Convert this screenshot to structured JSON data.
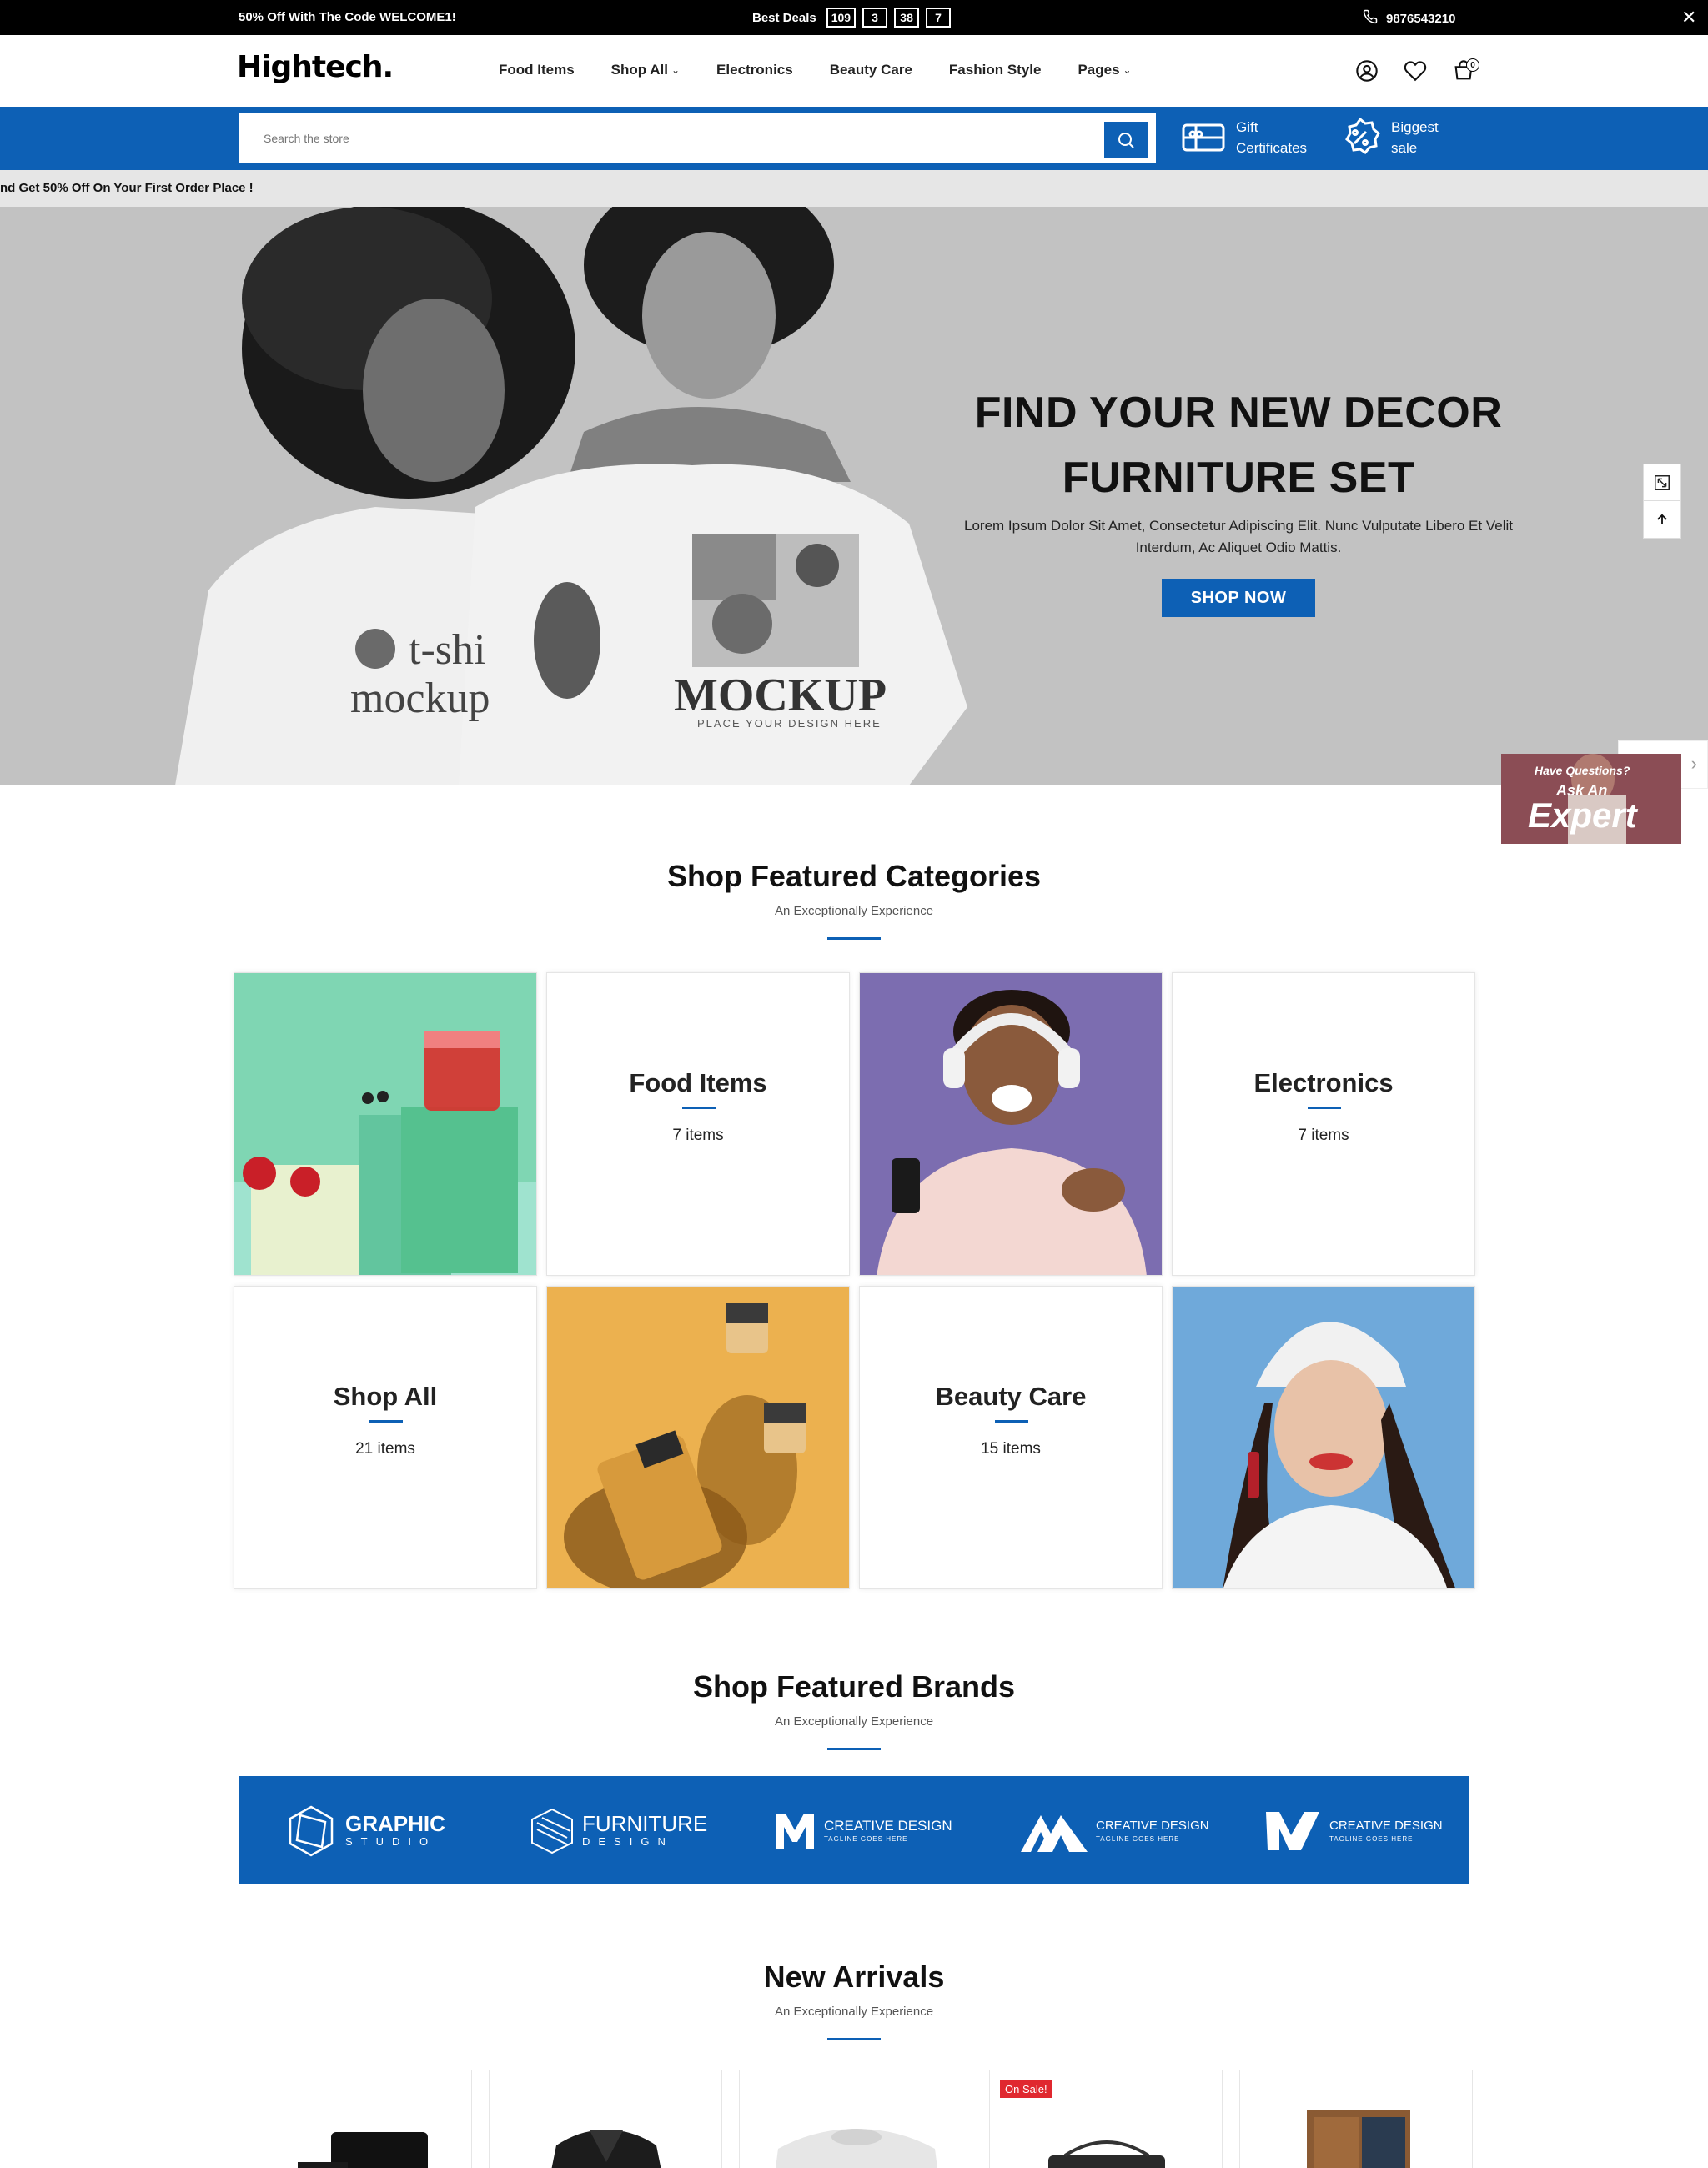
{
  "topbar": {
    "promo": "50% Off With The Code WELCOME1!",
    "deals_label": "Best Deals",
    "countdown": [
      "109",
      "3",
      "38",
      "7"
    ],
    "phone": "9876543210",
    "close": "✕"
  },
  "header": {
    "logo": "Hightech.",
    "nav": [
      {
        "label": "Food Items"
      },
      {
        "label": "Shop All",
        "dropdown": true
      },
      {
        "label": "Electronics"
      },
      {
        "label": "Beauty Care"
      },
      {
        "label": "Fashion Style"
      },
      {
        "label": "Pages",
        "dropdown": true
      }
    ],
    "cart_count": "0",
    "icons": [
      "account-icon",
      "wishlist-heart-icon",
      "cart-bag-icon"
    ]
  },
  "search": {
    "placeholder": "Search the store",
    "gift_label_1": "Gift",
    "gift_label_2": "Certificates",
    "sale_label_1": "Biggest",
    "sale_label_2": "sale"
  },
  "marquee": {
    "text": "nd Get 50% Off On Your First Order Place !"
  },
  "hero": {
    "title_line1": "FIND YOUR NEW DECOR",
    "title_line2": "FURNITURE SET",
    "body": "Lorem Ipsum Dolor Sit Amet, Consectetur Adipiscing Elit. Nunc Vulputate Libero Et Velit Interdum, Ac Aliquet Odio Mattis.",
    "cta": "SHOP NOW",
    "shirt_left_1": "t-shi",
    "shirt_left_2": "mockup",
    "shirt_right": "MOCKUP",
    "shirt_right_sub": "PLACE YOUR DESIGN HERE"
  },
  "expert": {
    "line1": "Have Questions?",
    "line2": "Ask An",
    "line3": "Expert"
  },
  "categories_section": {
    "title": "Shop Featured Categories",
    "subtitle": "An Exceptionally Experience",
    "cards": [
      {
        "name": "Food Items",
        "count": "7 items"
      },
      {
        "name": "Electronics",
        "count": "7 items"
      },
      {
        "name": "Shop All",
        "count": "21 items"
      },
      {
        "name": "Beauty Care",
        "count": "15 items"
      }
    ]
  },
  "brands_section": {
    "title": "Shop Featured Brands",
    "subtitle": "An Exceptionally Experience",
    "brands": [
      {
        "name": "GRAPHIC",
        "tag": "STUDIO"
      },
      {
        "name": "FURNITURE",
        "tag": "DESIGN"
      },
      {
        "name": "CREATIVE DESIGN",
        "tag": "TAGLINE GOES HERE"
      },
      {
        "name": "CREATIVE DESIGN",
        "tag": "TAGLINE GOES HERE"
      },
      {
        "name": "CREATIVE DESIGN",
        "tag": "TAGLINE GOES HERE"
      }
    ]
  },
  "arrivals_section": {
    "title": "New Arrivals",
    "subtitle": "An Exceptionally Experience",
    "sale_badge": "On Sale!"
  },
  "colors": {
    "brand_blue": "#0d60b5",
    "topbar": "#000000",
    "hero_bg": "#c2c2c2",
    "sale_red": "#e0282f"
  }
}
